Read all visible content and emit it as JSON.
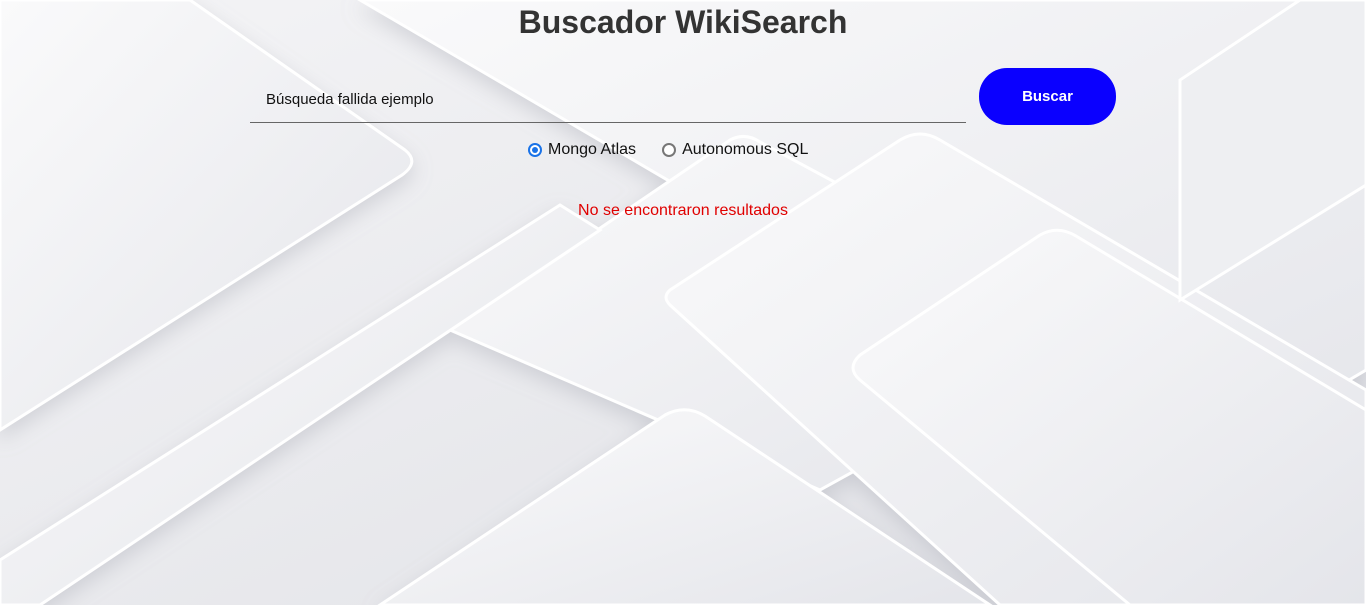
{
  "page": {
    "title": "Buscador WikiSearch"
  },
  "search": {
    "value": "Búsqueda fallida ejemplo",
    "button_label": "Buscar"
  },
  "sources": {
    "options": [
      {
        "label": "Mongo Atlas",
        "selected": true
      },
      {
        "label": "Autonomous SQL",
        "selected": false
      }
    ]
  },
  "results": {
    "message": "No se encontraron resultados"
  },
  "colors": {
    "accent": "#0a00ff",
    "radio_selected": "#1a73e8",
    "error": "#e00000",
    "title": "#333333"
  }
}
